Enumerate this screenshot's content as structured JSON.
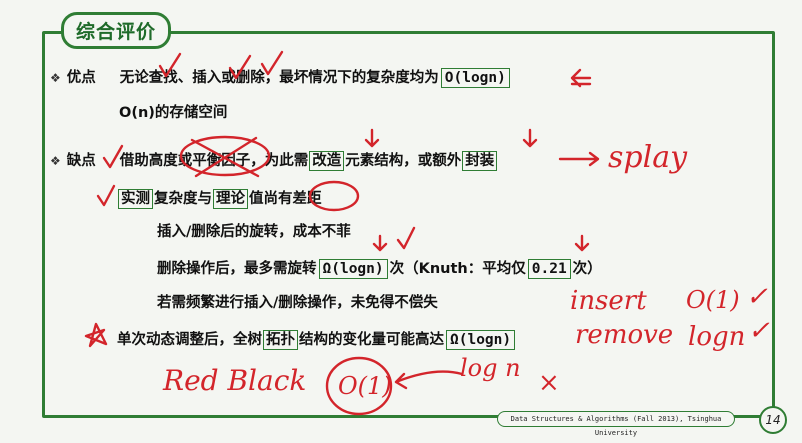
{
  "title": "综合评价",
  "pros": {
    "label": "优点",
    "line1_text": "无论查找、插入或删除，最坏情况下的复杂度均为",
    "line1_box": "O(logn)",
    "line2_text": "O(n)的存储空间"
  },
  "cons": {
    "label": "缺点",
    "line1_a": "借助高度或平衡因子，为此需",
    "line1_box1": "改造",
    "line1_b": "元素结构，或额外",
    "line1_box2": "封装",
    "line2_box1": "实测",
    "line2_a": "复杂度与",
    "line2_box2": "理论",
    "line2_b": "值尚有差距",
    "line3": "插入/删除后的旋转，成本不菲",
    "line4_a": "删除操作后，最多需旋转",
    "line4_box": "Ω(logn)",
    "line4_b": "次（Knuth：平均仅",
    "line4_box2": "0.21",
    "line4_c": "次）",
    "line5": "若需频繁进行插入/删除操作，未免得不偿失",
    "line6_a": "单次动态调整后，全树",
    "line6_box1": "拓扑",
    "line6_b": "结构的变化量可能高达",
    "line6_box2": "Ω(logn)"
  },
  "annotations": {
    "splay": "splay",
    "insert": "insert",
    "remove": "remove",
    "o1_a": "O(1)",
    "o1_b": "O(1)",
    "logn_a": "logn",
    "logn_b": "log n",
    "redblack": "Red Black",
    "cross": "×",
    "check": "✓"
  },
  "footer": "Data Structures & Algorithms (Fall 2013), Tsinghua University",
  "page_number": "14"
}
